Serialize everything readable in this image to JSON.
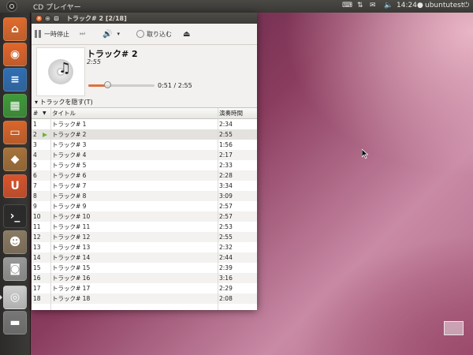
{
  "top_panel": {
    "app_title": "CD プレイヤー",
    "time": "14:24",
    "user": "ubuntutest"
  },
  "launcher": {
    "items": [
      {
        "name": "home-folder-icon",
        "color": "#e06b2d",
        "glyph": "⌂"
      },
      {
        "name": "firefox-icon",
        "color": "#e2662b",
        "glyph": "◉"
      },
      {
        "name": "writer-icon",
        "color": "#2f6fb5",
        "glyph": "≡"
      },
      {
        "name": "calc-icon",
        "color": "#3f9b3a",
        "glyph": "▦"
      },
      {
        "name": "impress-icon",
        "color": "#d9662a",
        "glyph": "▭"
      },
      {
        "name": "software-center-icon",
        "color": "#a7733b",
        "glyph": "◆"
      },
      {
        "name": "ubuntu-one-icon",
        "color": "#d9542c",
        "glyph": "U"
      },
      {
        "name": "terminal-icon",
        "color": "#2b2b2b",
        "glyph": "›_"
      },
      {
        "name": "gimp-icon",
        "color": "#8a7a62",
        "glyph": "☻"
      },
      {
        "name": "camera-icon",
        "color": "#9a9a9a",
        "glyph": "◙"
      },
      {
        "name": "cd-player-icon",
        "color": "#cfcfcf",
        "glyph": "◎"
      },
      {
        "name": "drive-icon",
        "color": "#777777",
        "glyph": "▬"
      }
    ]
  },
  "window": {
    "title": "トラック# 2  [2/18]",
    "toolbar": {
      "pause_label": "一時停止",
      "rip_label": "取り込む"
    },
    "track": {
      "title": "トラック# 2",
      "duration": "2:55",
      "time_label": "0:51 / 2:55",
      "progress": 0.29
    },
    "hide_tracks_label": "トラックを隠す(T)",
    "columns": {
      "number": "#",
      "title": "タイトル",
      "time": "演奏時間"
    },
    "tracks": [
      {
        "num": "1",
        "title": "トラック# 1",
        "time": "2:34"
      },
      {
        "num": "2",
        "title": "トラック# 2",
        "time": "2:55",
        "playing": true
      },
      {
        "num": "3",
        "title": "トラック# 3",
        "time": "1:56"
      },
      {
        "num": "4",
        "title": "トラック# 4",
        "time": "2:17"
      },
      {
        "num": "5",
        "title": "トラック# 5",
        "time": "2:33"
      },
      {
        "num": "6",
        "title": "トラック# 6",
        "time": "2:28"
      },
      {
        "num": "7",
        "title": "トラック# 7",
        "time": "3:34"
      },
      {
        "num": "8",
        "title": "トラック# 8",
        "time": "3:09"
      },
      {
        "num": "9",
        "title": "トラック# 9",
        "time": "2:57"
      },
      {
        "num": "10",
        "title": "トラック# 10",
        "time": "2:57"
      },
      {
        "num": "11",
        "title": "トラック# 11",
        "time": "2:53"
      },
      {
        "num": "12",
        "title": "トラック# 12",
        "time": "2:55"
      },
      {
        "num": "13",
        "title": "トラック# 13",
        "time": "2:32"
      },
      {
        "num": "14",
        "title": "トラック# 14",
        "time": "2:44"
      },
      {
        "num": "15",
        "title": "トラック# 15",
        "time": "2:39"
      },
      {
        "num": "16",
        "title": "トラック# 16",
        "time": "3:16"
      },
      {
        "num": "17",
        "title": "トラック# 17",
        "time": "2:29"
      },
      {
        "num": "18",
        "title": "トラック# 18",
        "time": "2:08"
      }
    ]
  }
}
